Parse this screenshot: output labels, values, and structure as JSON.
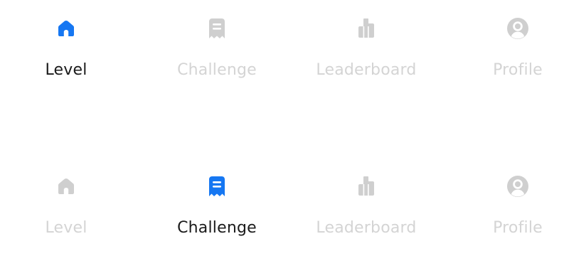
{
  "accent_color": "#1677f2",
  "inactive_color": "#cfcfcf",
  "active_text_color": "#1a1a1a",
  "tab_bars": [
    {
      "active_tab": "Level",
      "tabs": [
        {
          "label": "Level",
          "icon": "home-icon"
        },
        {
          "label": "Challenge",
          "icon": "challenge-icon"
        },
        {
          "label": "Leaderboard",
          "icon": "leaderboard-icon"
        },
        {
          "label": "Profile",
          "icon": "profile-icon"
        }
      ]
    },
    {
      "active_tab": "Challenge",
      "tabs": [
        {
          "label": "Level",
          "icon": "home-icon"
        },
        {
          "label": "Challenge",
          "icon": "challenge-icon"
        },
        {
          "label": "Leaderboard",
          "icon": "leaderboard-icon"
        },
        {
          "label": "Profile",
          "icon": "profile-icon"
        }
      ]
    }
  ]
}
